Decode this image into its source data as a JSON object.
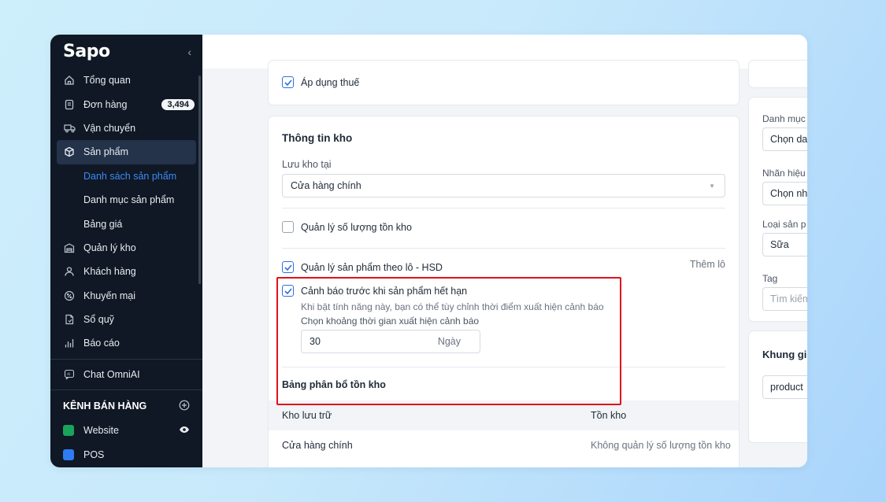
{
  "sidebar": {
    "logo": "Sapo",
    "collapse": "‹",
    "items": [
      {
        "label": "Tổng quan",
        "icon": "home-icon"
      },
      {
        "label": "Đơn hàng",
        "icon": "order-icon",
        "badge": "3,494"
      },
      {
        "label": "Vận chuyển",
        "icon": "truck-icon"
      },
      {
        "label": "Sản phẩm",
        "icon": "box-icon"
      },
      {
        "label": "Danh sách sản phẩm"
      },
      {
        "label": "Danh mục sản phẩm"
      },
      {
        "label": "Bảng giá"
      },
      {
        "label": "Quản lý kho",
        "icon": "warehouse-icon"
      },
      {
        "label": "Khách hàng",
        "icon": "user-icon"
      },
      {
        "label": "Khuyến mại",
        "icon": "discount-icon"
      },
      {
        "label": "Sổ quỹ",
        "icon": "cashbook-icon"
      },
      {
        "label": "Báo cáo",
        "icon": "chart-icon"
      },
      {
        "label": "Chat OmniAI",
        "icon": "ai-chat-icon"
      }
    ],
    "channels_title": "KÊNH BÁN HÀNG",
    "channels": [
      {
        "label": "Website"
      },
      {
        "label": "POS"
      }
    ]
  },
  "tax_card": {
    "apply_tax": "Áp dụng thuế"
  },
  "inventory": {
    "title": "Thông tin kho",
    "store_at_label": "Lưu kho tại",
    "store_at_value": "Cửa hàng chính",
    "manage_qty": "Quản lý số lượng tồn kho",
    "manage_lot": "Quản lý sản phẩm theo lô - HSD",
    "add_lot": "Thêm lô",
    "expiry_warning": "Cảnh báo trước khi sản phẩm hết hạn",
    "expiry_help": "Khi bật tính năng này, bạn có thể tùy chỉnh thời điểm xuất hiện cảnh báo",
    "expiry_period_label": "Chọn khoảng thời gian xuất hiện cảnh báo",
    "expiry_days_value": "30",
    "expiry_days_unit": "Ngày",
    "allocation_title": "Bảng phân bổ tồn kho",
    "table_headers": [
      "Kho lưu trữ",
      "Tồn kho"
    ],
    "table_rows": [
      {
        "store": "Cửa hàng chính",
        "stock": "Không quản lý số lượng tồn kho"
      }
    ]
  },
  "right_panel": {
    "category_label": "Danh mục",
    "category_value": "Chọn da",
    "brand_label": "Nhãn hiệu",
    "brand_value": "Chọn nh",
    "type_label": "Loại sản p",
    "type_value": "Sữa",
    "tag_label": "Tag",
    "tag_placeholder": "Tìm kiếm",
    "frame_title": "Khung gi",
    "frame_value": "product"
  },
  "colors": {
    "sidebar_bg": "#0f1824",
    "accent": "#2f6ee0",
    "highlight": "#e0121b"
  }
}
